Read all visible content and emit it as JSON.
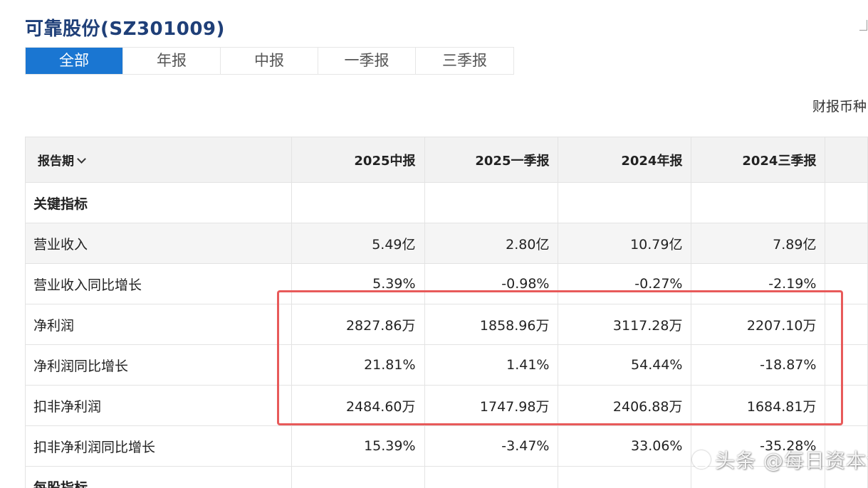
{
  "page": {
    "title": "可靠股份(SZ301009)"
  },
  "tabs": [
    {
      "label": "全部",
      "active": true
    },
    {
      "label": "年报",
      "active": false
    },
    {
      "label": "中报",
      "active": false
    },
    {
      "label": "一季报",
      "active": false
    },
    {
      "label": "三季报",
      "active": false
    }
  ],
  "currency_label": "财报币种",
  "table": {
    "period_header": "报告期",
    "columns": [
      "2025中报",
      "2025一季报",
      "2024年报",
      "2024三季报"
    ],
    "rows": [
      {
        "label": "关键指标",
        "section": true,
        "values": [
          "",
          "",
          "",
          ""
        ]
      },
      {
        "label": "营业收入",
        "values": [
          "5.49亿",
          "2.80亿",
          "10.79亿",
          "7.89亿"
        ]
      },
      {
        "label": "营业收入同比增长",
        "values": [
          "5.39%",
          "-0.98%",
          "-0.27%",
          "-2.19%"
        ]
      },
      {
        "label": "净利润",
        "values": [
          "2827.86万",
          "1858.96万",
          "3117.28万",
          "2207.10万"
        ]
      },
      {
        "label": "净利润同比增长",
        "values": [
          "21.81%",
          "1.41%",
          "54.44%",
          "-18.87%"
        ]
      },
      {
        "label": "扣非净利润",
        "values": [
          "2484.60万",
          "1747.98万",
          "2406.88万",
          "1684.81万"
        ]
      },
      {
        "label": "扣非净利润同比增长",
        "values": [
          "15.39%",
          "-3.47%",
          "33.06%",
          "-35.28%"
        ]
      },
      {
        "label": "每股指标",
        "section": true,
        "values": [
          "",
          "",
          "",
          ""
        ]
      }
    ]
  },
  "watermark": "头条 @每日资本论",
  "colors": {
    "title": "#1f3f78",
    "tab_active_bg": "#1a76d2",
    "highlight_border": "#e85a5a",
    "header_bg": "#f2f2f2"
  }
}
